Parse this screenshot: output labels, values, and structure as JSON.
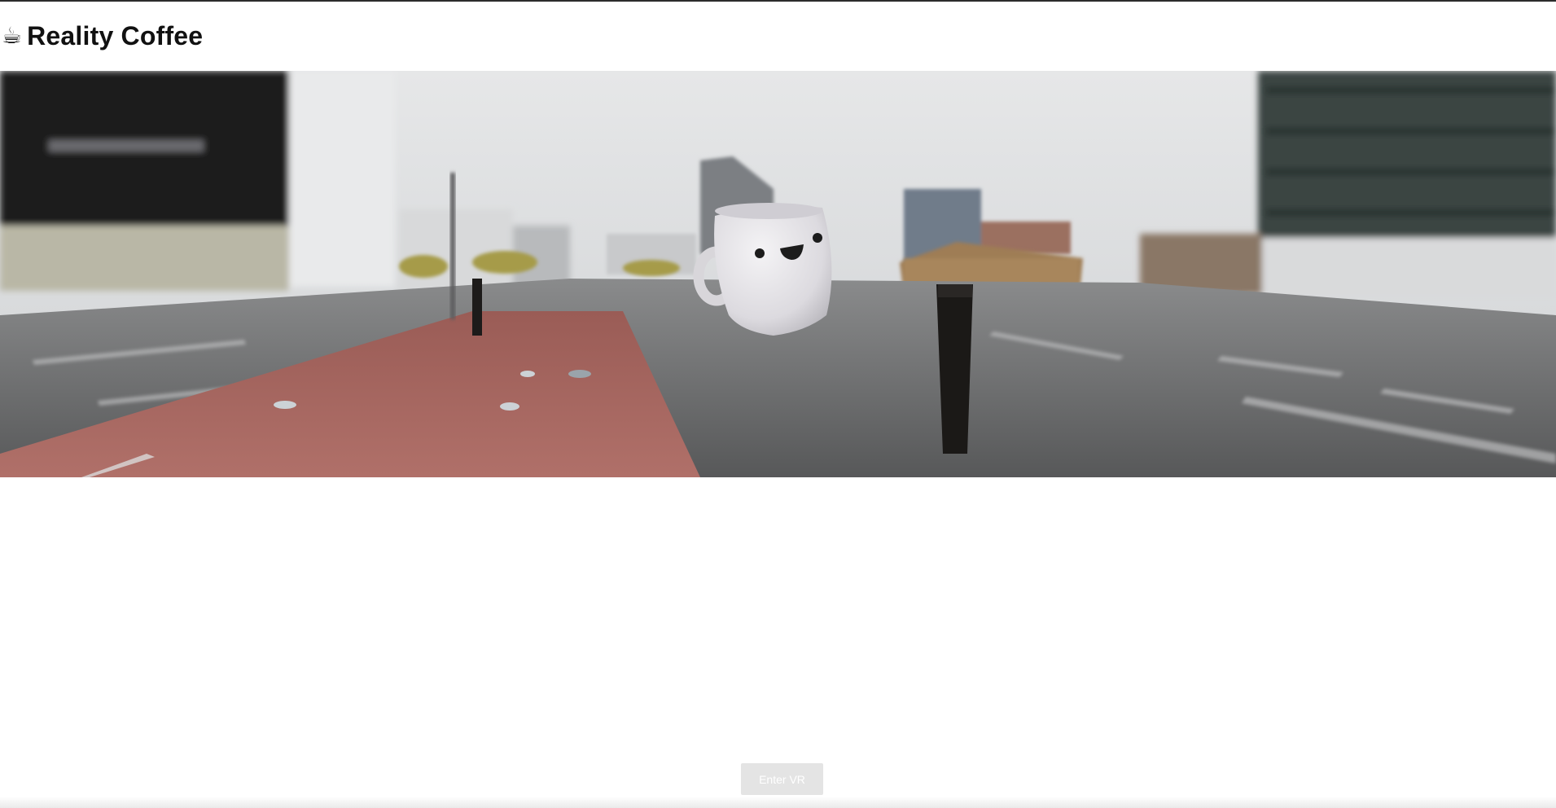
{
  "header": {
    "icon": "coffee-cup-icon",
    "icon_glyph": "☕",
    "title": "Reality Coffee"
  },
  "scene": {
    "icon": "smiling-mug-icon",
    "description_colors": {
      "sky": "#e3e4e5",
      "road": "#5e5f60",
      "bike_lane": "#a86a62",
      "mug": "#e9e7ea"
    }
  },
  "vr_button": {
    "label": "Enter VR"
  }
}
